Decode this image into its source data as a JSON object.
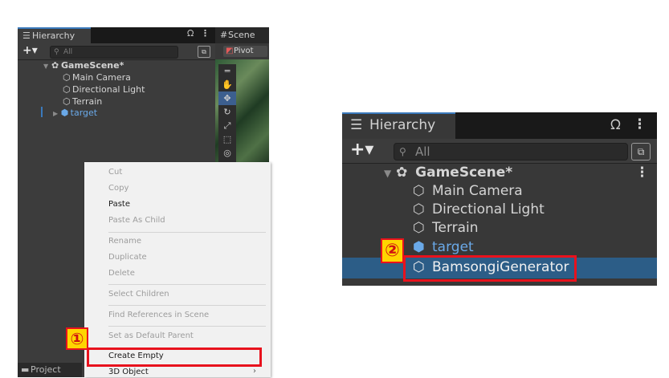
{
  "left_panel": {
    "hierarchy_tab": {
      "icon": "list-icon",
      "label": "Hierarchy"
    },
    "scene_tab": {
      "icon": "hash-icon",
      "label": "Scene"
    },
    "search_placeholder": "All",
    "pivot_label": "Pivot",
    "tree": [
      {
        "label": "GameScene*",
        "icon": "unity-scene-icon"
      },
      {
        "label": "Main Camera",
        "icon": "cube-icon"
      },
      {
        "label": "Directional Light",
        "icon": "cube-icon"
      },
      {
        "label": "Terrain",
        "icon": "cube-icon"
      },
      {
        "label": "target",
        "icon": "prefab-icon",
        "color": "#6aa9e8"
      }
    ],
    "bottom_tab": "Project"
  },
  "context_menu": {
    "items": [
      {
        "label": "Cut",
        "enabled": false
      },
      {
        "label": "Copy",
        "enabled": false
      },
      {
        "label": "Paste",
        "enabled": true
      },
      {
        "label": "Paste As Child",
        "enabled": false
      },
      {
        "label": "Rename",
        "enabled": false
      },
      {
        "label": "Duplicate",
        "enabled": false
      },
      {
        "label": "Delete",
        "enabled": false
      },
      {
        "label": "Select Children",
        "enabled": false
      },
      {
        "label": "Find References in Scene",
        "enabled": false
      },
      {
        "label": "Set as Default Parent",
        "enabled": false
      },
      {
        "label": "Create Empty",
        "enabled": true
      },
      {
        "label": "3D Object",
        "enabled": true
      }
    ]
  },
  "annotations": {
    "step1": "①",
    "step2": "②",
    "highlight_color": "#e8121d",
    "badge_color": "#ffd500"
  },
  "right_panel": {
    "hierarchy_tab": {
      "icon": "list-icon",
      "label": "Hierarchy"
    },
    "search_placeholder": "All",
    "tree": [
      {
        "label": "GameScene*",
        "icon": "unity-scene-icon"
      },
      {
        "label": "Main Camera",
        "icon": "cube-icon"
      },
      {
        "label": "Directional Light",
        "icon": "cube-icon"
      },
      {
        "label": "Terrain",
        "icon": "cube-icon"
      },
      {
        "label": "target",
        "icon": "prefab-icon",
        "color": "#6aa9e8"
      },
      {
        "label": "BamsongiGenerator",
        "icon": "cube-icon",
        "selected": true
      }
    ],
    "selection_color": "#2c5d87"
  }
}
